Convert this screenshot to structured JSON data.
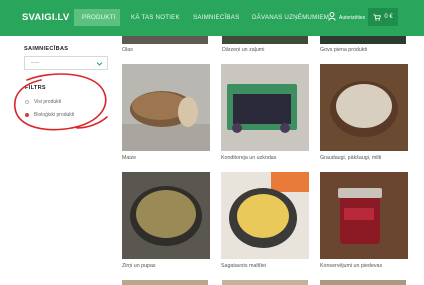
{
  "header": {
    "logo": "SVAIGI.LV",
    "nav": [
      {
        "label": "PRODUKTI",
        "active": true
      },
      {
        "label": "KĀ TAS NOTIEK",
        "active": false
      },
      {
        "label": "SAIMNIECĪBAS",
        "active": false
      },
      {
        "label": "DĀVANAS UZŅĒMUMIEM",
        "active": false
      }
    ],
    "user_label": "Autorizēties",
    "cart": "0 €",
    "cart_icon": "cart-icon",
    "user_icon": "user-icon"
  },
  "sidebar": {
    "title": "SAIMNIECĪBAS",
    "select_value": "-----",
    "filter_title": "FILTRS",
    "filters": [
      {
        "label": "Visi produkti",
        "selected": false
      },
      {
        "label": "Bioloģiski produkti",
        "selected": true
      }
    ]
  },
  "products": {
    "top_row": [
      "Olas",
      "Dārzeņi un zaļumi",
      "Govs piena produkti"
    ],
    "rows": [
      [
        "Maize",
        "Konditoreja un uzkodas",
        "Graudaugi, pākšaugi, milti"
      ],
      [
        "Zirņi un pupas",
        "Sagatavots maltītei",
        "Konservējumi un piedevas"
      ]
    ]
  },
  "colors": {
    "brand_green": "#2aa55c",
    "accent_red": "#d83a3a"
  }
}
